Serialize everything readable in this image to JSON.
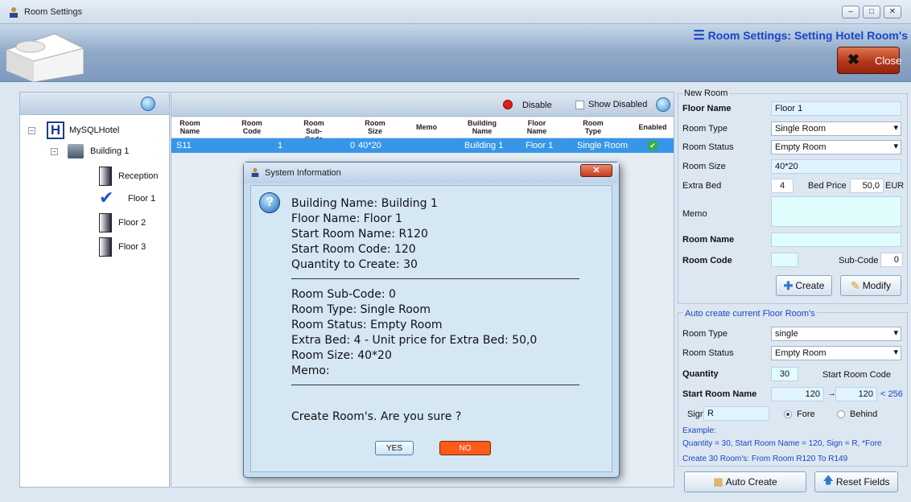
{
  "window": {
    "title": "Room Settings"
  },
  "header": {
    "heading": "Room Settings: Setting Hotel Room's",
    "close_label": "Close"
  },
  "tree": {
    "root": "MySQLHotel",
    "building": "Building 1",
    "floors": [
      "Reception",
      "Floor 1",
      "Floor 2",
      "Floor 3"
    ]
  },
  "grid": {
    "toolbar": {
      "disable_label": "Disable",
      "show_disabled_label": "Show Disabled"
    },
    "columns": [
      "Room Name",
      "Room Code",
      "Room Sub-Code",
      "Room Size",
      "Memo",
      "Building Name",
      "Floor Name",
      "Room Type",
      "Enabled"
    ],
    "rows": [
      {
        "room_name": "S11",
        "room_code": "1",
        "sub_code": "0",
        "room_size": "40*20",
        "memo": "",
        "building": "Building 1",
        "floor": "Floor 1",
        "room_type": "Single Room",
        "enabled": "✔"
      }
    ]
  },
  "new_room": {
    "legend": "New Room",
    "floor_name_label": "Floor Name",
    "floor_name_value": "Floor 1",
    "room_type_label": "Room Type",
    "room_type_value": "Single Room",
    "room_status_label": "Room Status",
    "room_status_value": "Empty Room",
    "room_size_label": "Room Size",
    "room_size_value": "40*20",
    "extra_bed_label": "Extra Bed",
    "extra_bed_value": "4",
    "bed_price_label": "Bed Price",
    "bed_price_value": "50,0",
    "currency": "EUR",
    "memo_label": "Memo",
    "memo_value": "",
    "room_name_label": "Room Name",
    "room_name_value": "",
    "room_code_label": "Room Code",
    "room_code_value": "",
    "sub_code_label": "Sub-Code",
    "sub_code_value": "0",
    "create_label": "Create",
    "modify_label": "Modify"
  },
  "auto_create": {
    "legend": "Auto create current Floor Room's",
    "room_type_label": "Room Type",
    "room_type_value": "single",
    "room_status_label": "Room Status",
    "room_status_value": "Empty Room",
    "quantity_label": "Quantity",
    "quantity_value": "30",
    "start_room_code_label": "Start Room Code",
    "start_room_name_label": "Start Room Name",
    "start_room_name_value": "120",
    "start_room_code_value": "120",
    "max_hint": "< 256",
    "arrow": "→",
    "sign_label": "Sign",
    "sign_value": "R",
    "fore_label": "Fore",
    "behind_label": "Behind",
    "example_label": "Example:",
    "example_line1": "Quantity = 30, Start Room Name = 120, Sign = R, *Fore",
    "example_line2": "Create 30 Room's: From Room R120 To R149",
    "auto_create_label": "Auto Create",
    "reset_label": "Reset Fields"
  },
  "dialog": {
    "title": "System Information",
    "lines_top": [
      "Building Name: Building 1",
      "Floor Name: Floor 1",
      "Start Room Name: R120",
      "Start Room Code: 120",
      "Quantity to Create: 30"
    ],
    "lines_mid": [
      "Room Sub-Code: 0",
      "Room Type: Single Room",
      "Room Status: Empty Room",
      "Extra Bed: 4 - Unit price for Extra Bed: 50,0",
      "Room Size: 40*20",
      "Memo:"
    ],
    "question": "Create Room's. Are you sure ?",
    "yes_label": "YES",
    "no_label": "NO"
  },
  "colors": {
    "accent": "#1846c8",
    "selected_row": "#3796e8",
    "close_button": "#b3371a",
    "no_button": "#ff5a1a"
  }
}
